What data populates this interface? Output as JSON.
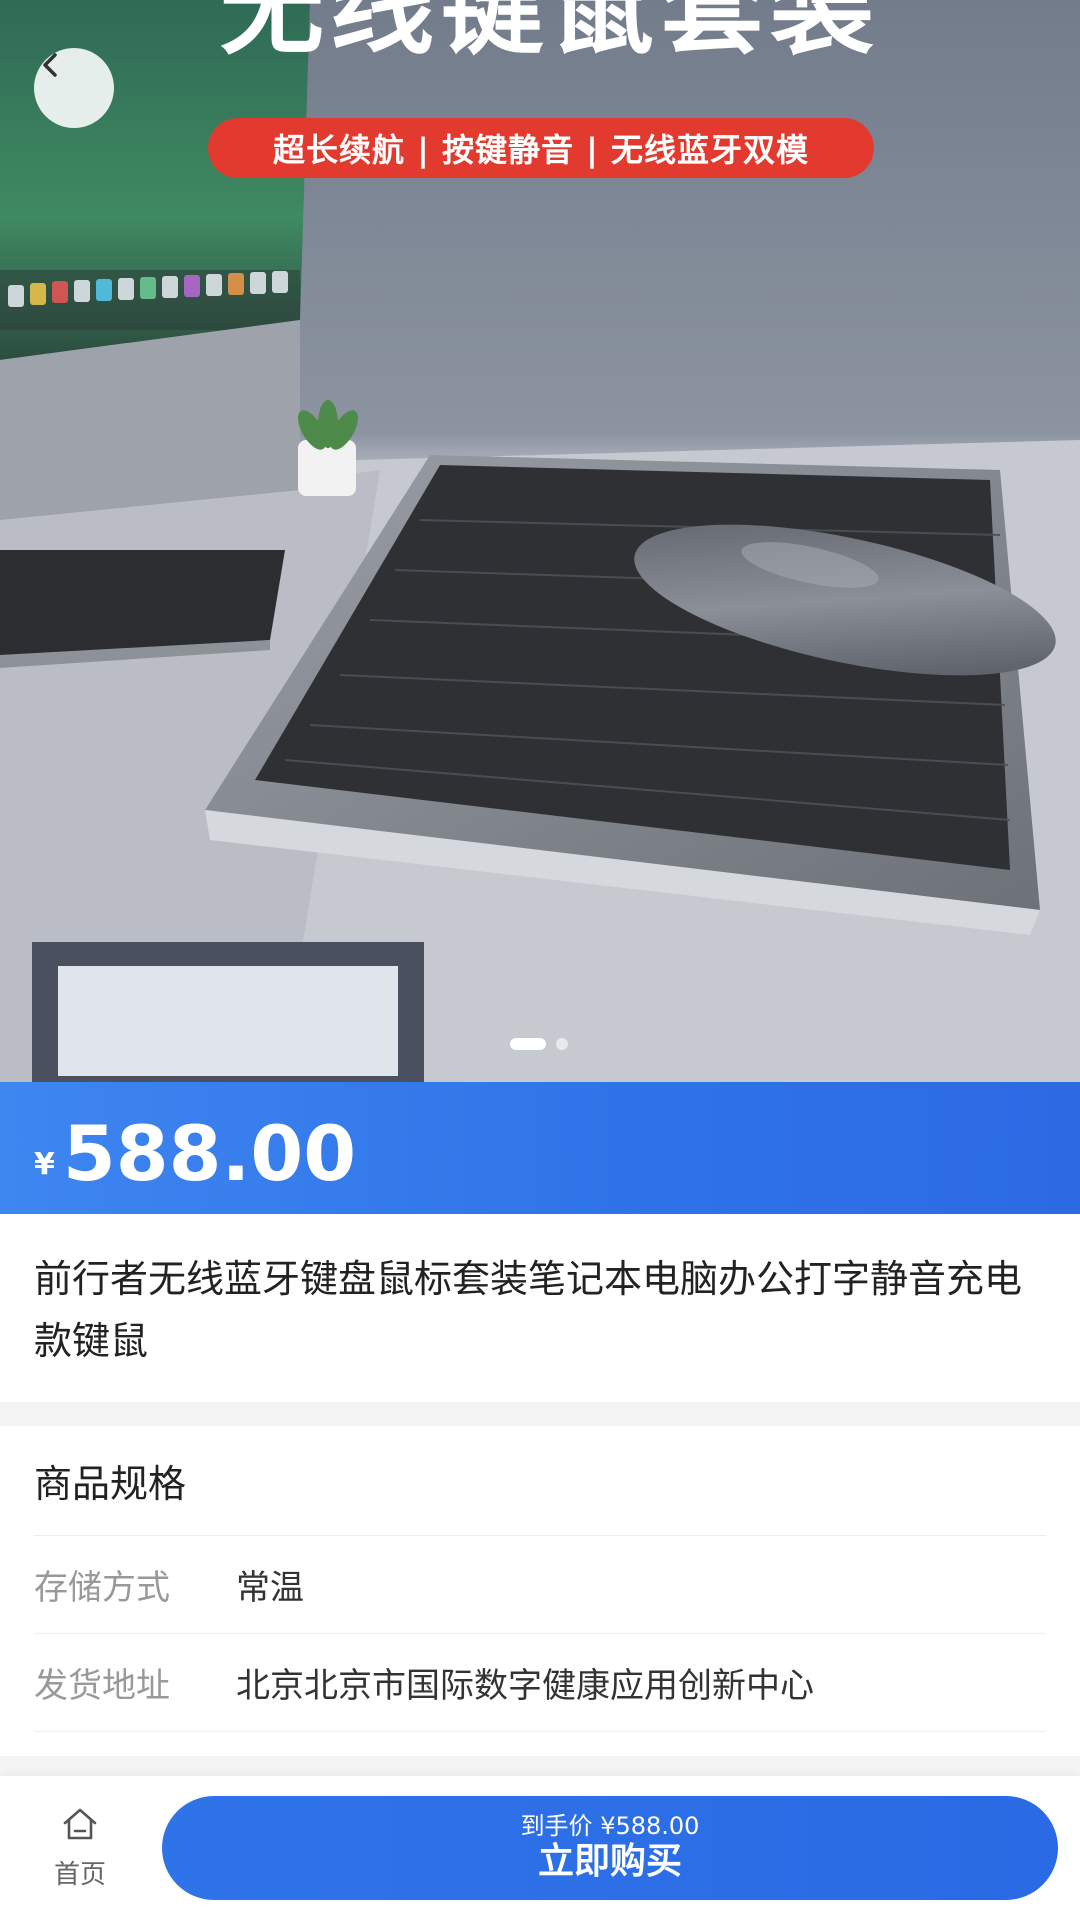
{
  "hero": {
    "title": "无线键鼠套装",
    "tagline": "超长续航 | 按键静音 | 无线蓝牙双模",
    "slide_count": 2,
    "active_slide": 1
  },
  "price": {
    "currency": "¥",
    "amount": "588.00"
  },
  "product": {
    "title": "前行者无线蓝牙键盘鼠标套装笔记本电脑办公打字静音充电款键鼠"
  },
  "specs": {
    "header": "商品规格",
    "rows": [
      {
        "label": "存储方式",
        "value": "常温"
      },
      {
        "label": "发货地址",
        "value": "北京北京市国际数字健康应用创新中心"
      }
    ]
  },
  "bottom_bar": {
    "home_label": "首页",
    "buy_subtitle": "到手价 ¥588.00",
    "buy_label": "立即购买"
  },
  "colors": {
    "accent": "#2f72e8",
    "tagline_bg": "#e23a2f"
  },
  "icons": {
    "back": "chevron-left-icon",
    "home": "home-icon"
  }
}
